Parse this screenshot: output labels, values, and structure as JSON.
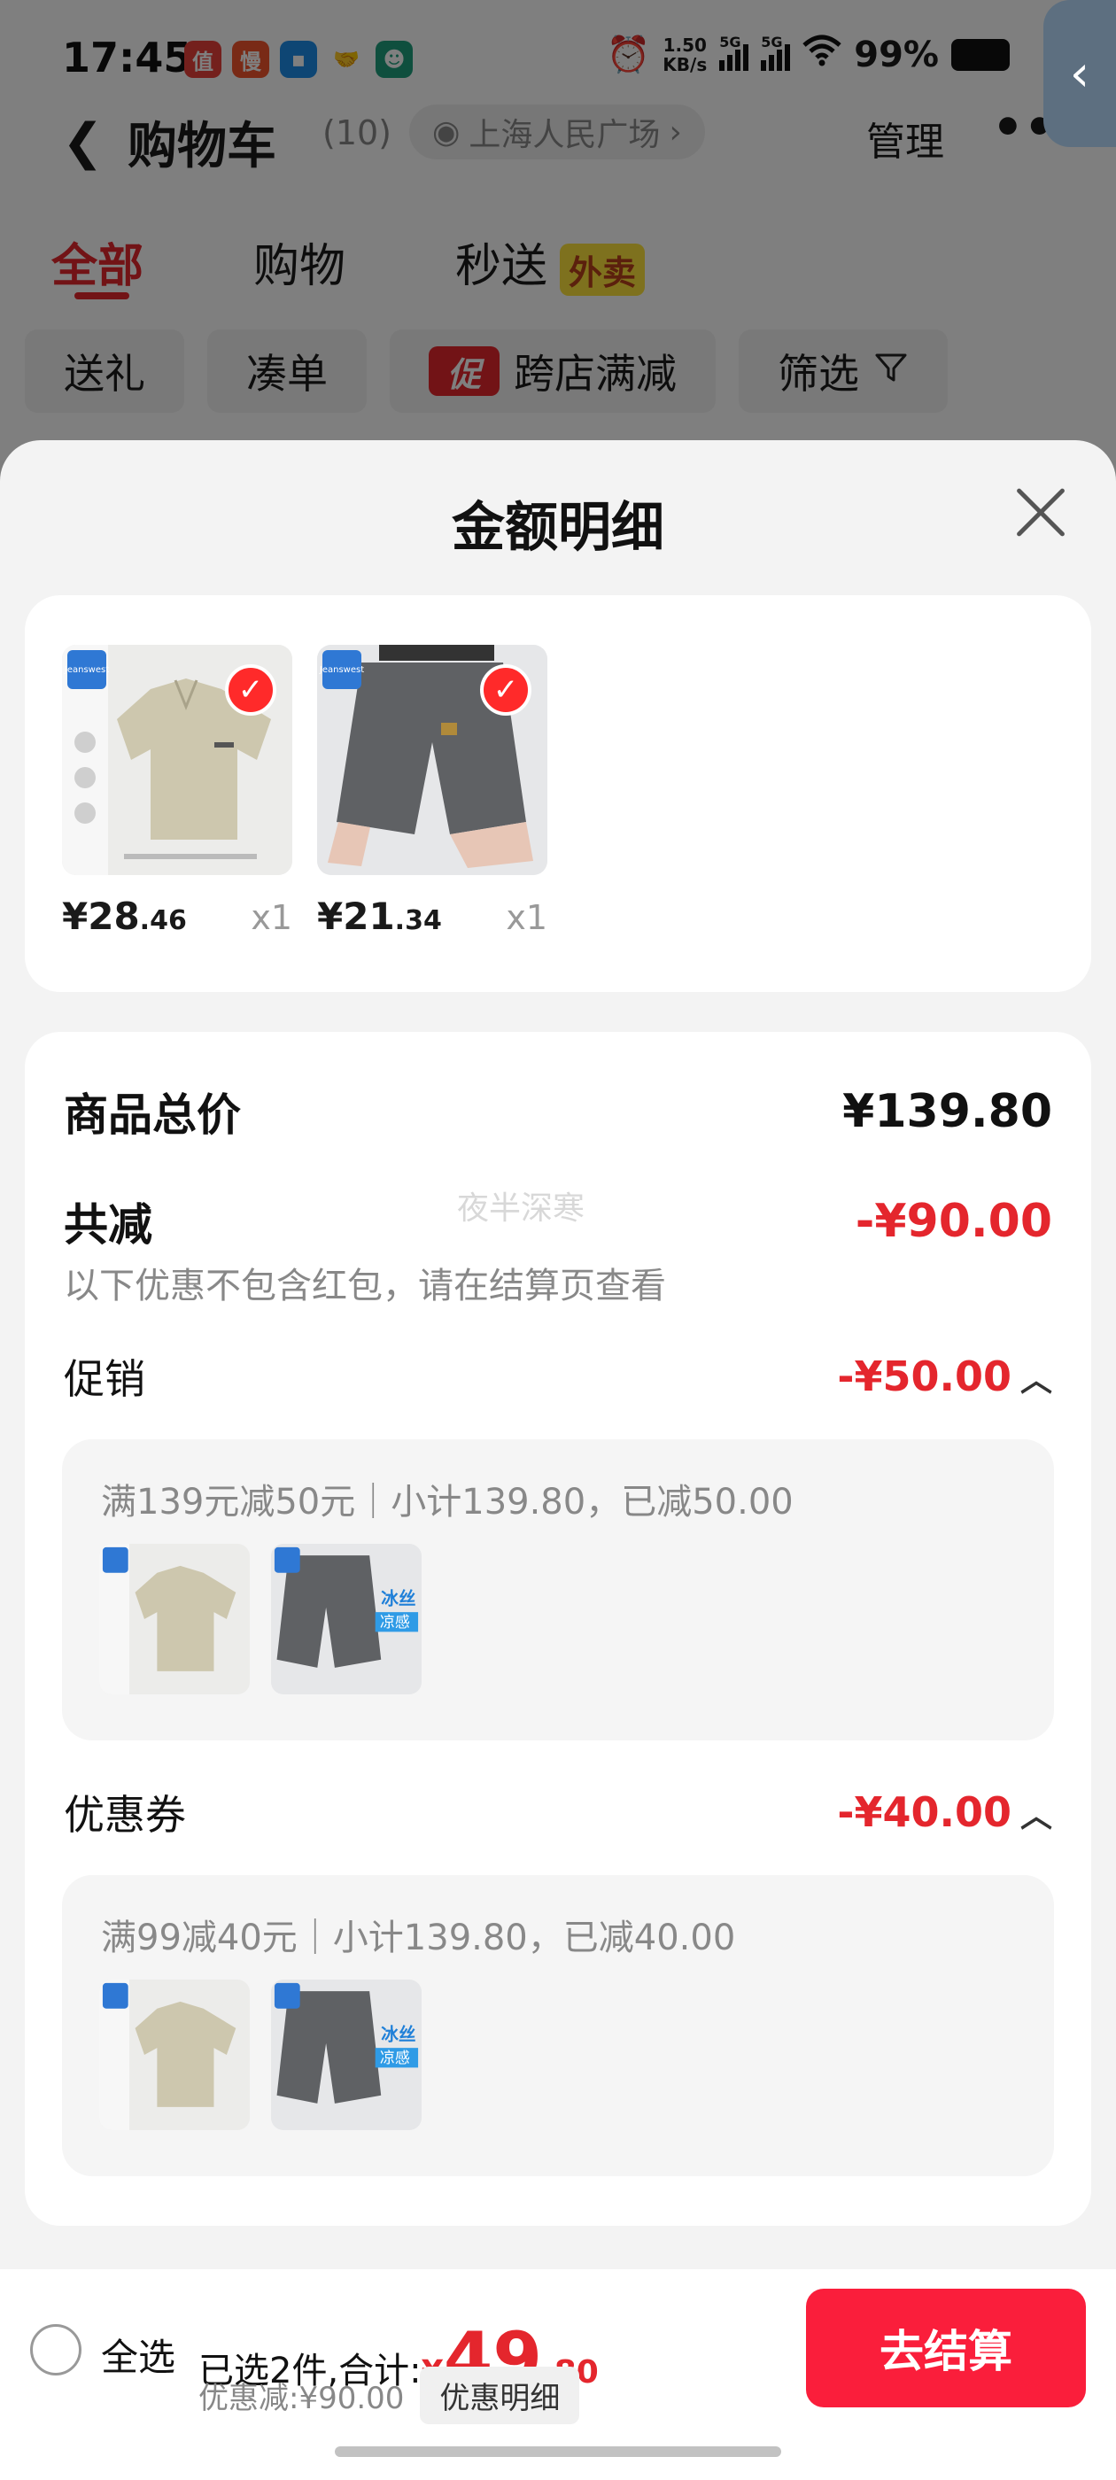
{
  "status_bar": {
    "time": "17:45",
    "apps": [
      {
        "icon": "zhidemai-app-icon",
        "glyph": "值",
        "color": "#e8403a"
      },
      {
        "icon": "man-app-icon",
        "glyph": "慢",
        "color": "#f2552c"
      },
      {
        "icon": "blue-app-icon",
        "glyph": "▪",
        "color": "#1c8ce8"
      },
      {
        "icon": "handshake-app-icon",
        "glyph": "🤝",
        "color": "#333333"
      },
      {
        "icon": "avatar-app-icon",
        "glyph": "☻",
        "color": "#1f9e7c"
      }
    ],
    "net_speed_value": "1.50",
    "net_speed_unit": "KB/s",
    "sim1_tag": "5G",
    "sim2_tag": "5G",
    "battery_text": "99%"
  },
  "navbar": {
    "title": "购物车",
    "count": "(10)",
    "location": "上海人民广场",
    "manage": "管理",
    "more": "•••"
  },
  "tabs": [
    {
      "label": "全部",
      "active": true
    },
    {
      "label": "购物",
      "active": false
    },
    {
      "label": "秒送",
      "active": false,
      "badge": "外卖"
    }
  ],
  "filters": {
    "gift": "送礼",
    "bundle": "凑单",
    "promo_tag": "促",
    "cross_store": "跨店满减",
    "filter": "筛选"
  },
  "sheet": {
    "title": "金额明细",
    "products": [
      {
        "price_int": "¥28",
        "price_dec": ".46",
        "qty": "x1",
        "kind": "polo-shirt"
      },
      {
        "price_int": "¥21",
        "price_dec": ".34",
        "qty": "x1",
        "kind": "shorts"
      }
    ],
    "total_label": "商品总价",
    "total_value": "¥139.80",
    "reduce_label": "共减",
    "reduce_value": "-¥90.00",
    "reduce_note": "以下优惠不包含红包，请在结算页查看",
    "watermark": "夜半深寒",
    "promotion": {
      "label": "促销",
      "value": "-¥50.00",
      "detail": "满139元减50元｜小计139.80，已减50.00"
    },
    "coupon": {
      "label": "优惠券",
      "value": "-¥40.00",
      "detail": "满99减40元｜小计139.80，已减40.00"
    },
    "product_overlays": {
      "brand": "Jeanswest",
      "shorts_tag_1": "冰丝",
      "shorts_tag_2": "凉感"
    }
  },
  "footer": {
    "select_all": "全选",
    "selected_prefix": "已选2件,合计:",
    "total_yen": "¥",
    "total_int": "49",
    "total_dec": ".80",
    "discount": "优惠减:¥90.00",
    "detail_button": "优惠明细",
    "checkout": "去结算"
  },
  "colors": {
    "accent_red": "#e4262d",
    "checkout_red": "#fa1e3b",
    "sheet_bg": "#f3f3f3"
  }
}
